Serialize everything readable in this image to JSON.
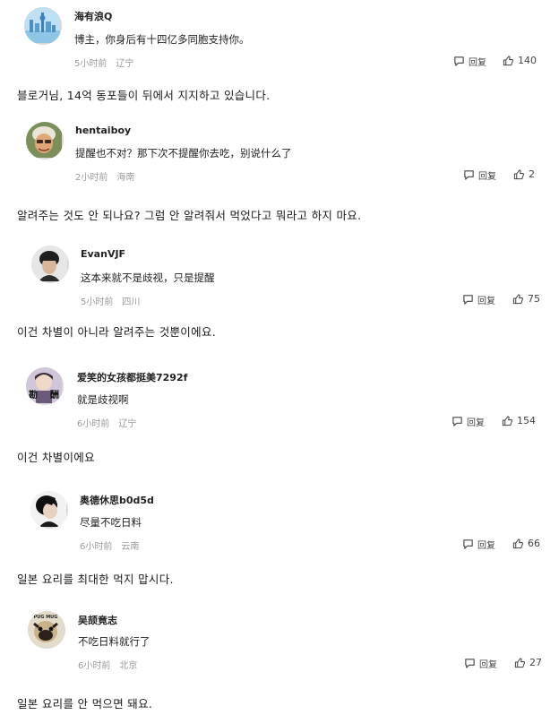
{
  "labels": {
    "reply": "回复"
  },
  "comments": [
    {
      "username": "海有浪Q",
      "text": "博主，你身后有十四亿多同胞支持你。",
      "time": "5小时前",
      "location": "辽宁",
      "likes": "140",
      "translation": "블로거님, 14억 동포들이 뒤에서 지지하고 있습니다."
    },
    {
      "username": "hentaiboy",
      "text": "提醒也不对？那下次不提醒你去吃，别说什么了",
      "time": "2小时前",
      "location": "海南",
      "likes": "2",
      "translation": "알려주는 것도 안 되나요? 그럼 안 알려줘서 먹었다고 뭐라고 하지 마요."
    },
    {
      "username": "EvanVJF",
      "text": "这本来就不是歧视，只是提醒",
      "time": "5小时前",
      "location": "四川",
      "likes": "75",
      "translation": "이건 차별이 아니라 알려주는 것뿐이에요."
    },
    {
      "username": "爱笑的女孩都挺美7292f",
      "text": "就是歧视啊",
      "time": "6小时前",
      "location": "辽宁",
      "likes": "154",
      "translation": "이건 차별이에요"
    },
    {
      "username": "奥德休思b0d5d",
      "text": "尽量不吃日料",
      "time": "6小时前",
      "location": "云南",
      "likes": "66",
      "translation": "일본 요리를 최대한 먹지 맙시다."
    },
    {
      "username": "吴颉竟志",
      "text": "不吃日料就行了",
      "time": "6小时前",
      "location": "北京",
      "likes": "27",
      "translation": "일본 요리를 안 먹으면 돼요."
    }
  ],
  "avatars": [
    "city-skyline-avatar",
    "man-cartoon-avatar",
    "person-photo-avatar",
    "character-avatar",
    "dark-hair-avatar",
    "pug-dog-avatar"
  ],
  "avatar_text": {
    "a4_left": "勘",
    "a4_right": "酬",
    "a6_badge": "PUG MUG"
  }
}
